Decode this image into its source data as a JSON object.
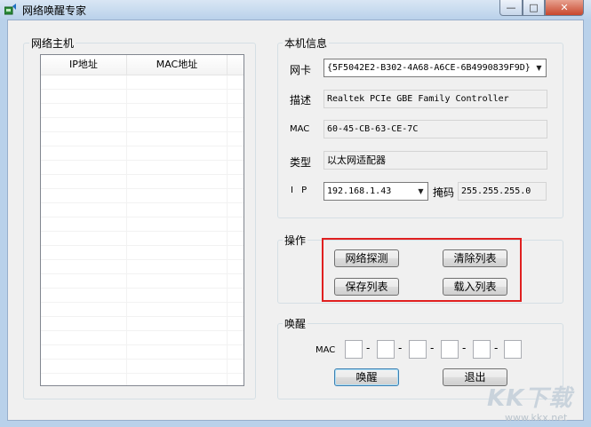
{
  "window": {
    "title": "网络唤醒专家",
    "minimize_glyph": "—",
    "maximize_glyph": "□",
    "close_glyph": "✕"
  },
  "hosts": {
    "group_label": "网络主机",
    "columns": [
      "IP地址",
      "MAC地址"
    ],
    "rows": []
  },
  "local": {
    "group_label": "本机信息",
    "nic_label": "网卡",
    "nic_value": "{5F5042E2-B302-4A68-A6CE-6B4990839F9D}",
    "desc_label": "描述",
    "desc_value": "Realtek PCIe GBE Family Controller",
    "mac_label": "MAC",
    "mac_value": "60-45-CB-63-CE-7C",
    "type_label": "类型",
    "type_value": "以太网适配器",
    "ip_label": "I P",
    "ip_value": "192.168.1.43",
    "mask_label": "掩码",
    "mask_value": "255.255.255.0"
  },
  "ops": {
    "group_label": "操作",
    "probe": "网络探测",
    "clear": "清除列表",
    "save": "保存列表",
    "load": "载入列表"
  },
  "wake": {
    "group_label": "唤醒",
    "mac_label": "MAC",
    "dash": "-",
    "wake_button": "唤醒",
    "exit_button": "退出"
  },
  "watermark": {
    "big": "KK下载",
    "small": "www.kkx.net"
  },
  "icons": {
    "dropdown": "▼"
  },
  "colors": {
    "highlight": "#e02020",
    "frame": "#b9d1ea"
  }
}
